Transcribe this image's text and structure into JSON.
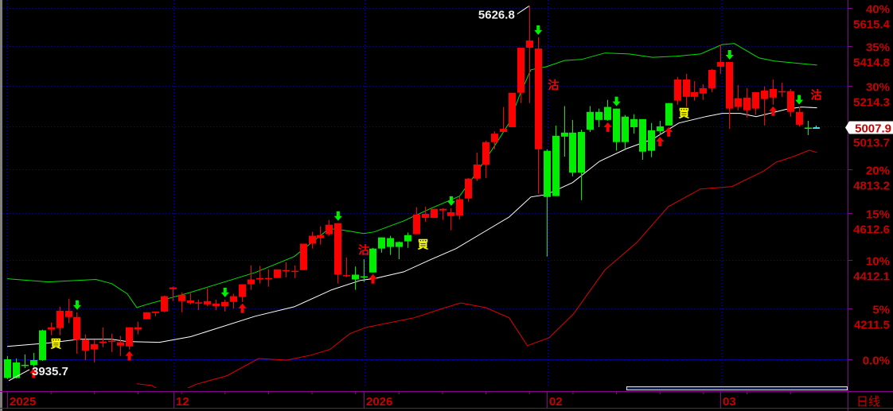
{
  "chart_data": {
    "type": "candlestick",
    "period_label": "日线",
    "y_scale": "log",
    "base_price": 4011,
    "last_price": "5007.9",
    "ylim": [
      3899,
      5657
    ],
    "y_ticks": [
      {
        "pct": "40%",
        "price": "5615.4",
        "ratio": 1.4
      },
      {
        "pct": "35%",
        "price": "5414.8",
        "ratio": 1.35
      },
      {
        "pct": "30%",
        "price": "5214.3",
        "ratio": 1.3
      },
      {
        "pct": "",
        "price": "5013.7",
        "ratio": 1.25
      },
      {
        "pct": "20%",
        "price": "4813.2",
        "ratio": 1.2
      },
      {
        "pct": "15%",
        "price": "4612.6",
        "ratio": 1.15
      },
      {
        "pct": "10%",
        "price": "4412.1",
        "ratio": 1.1
      },
      {
        "pct": "5%",
        "price": "4211.5",
        "ratio": 1.05
      },
      {
        "pct": "0.0%",
        "price": "",
        "ratio": 1.0
      }
    ],
    "x_labels": [
      {
        "label": "2025",
        "index": 0
      },
      {
        "label": "12",
        "index": 19.1
      },
      {
        "label": "2026",
        "index": 41
      },
      {
        "label": "02",
        "index": 62
      },
      {
        "label": "03",
        "index": 82
      }
    ],
    "candles_ohlc": [
      [
        4011,
        4024,
        3936,
        3940
      ],
      [
        3999,
        4014,
        3938,
        3940
      ],
      [
        3990,
        4030,
        3977,
        3989
      ],
      [
        4008,
        4036,
        3983,
        3989
      ],
      [
        4124,
        4127,
        4005,
        4008
      ],
      [
        4127,
        4155,
        4105,
        4136
      ],
      [
        4133,
        4218,
        4105,
        4202
      ],
      [
        4177,
        4251,
        4152,
        4202
      ],
      [
        4086,
        4196,
        4033,
        4177
      ],
      [
        4045,
        4108,
        4008,
        4086
      ],
      [
        4049,
        4086,
        3999,
        4070
      ],
      [
        4074,
        4136,
        4058,
        4080
      ],
      [
        4080,
        4111,
        4039,
        4083
      ],
      [
        4064,
        4102,
        4024,
        4077
      ],
      [
        4061,
        4136,
        4049,
        4136
      ],
      [
        4127,
        4158,
        4108,
        4136
      ],
      [
        4168,
        4196,
        4168,
        4196
      ],
      [
        4193,
        4199,
        4180,
        4199
      ],
      [
        4199,
        4264,
        4196,
        4261
      ],
      [
        4290,
        4300,
        4241,
        4297
      ],
      [
        4241,
        4277,
        4196,
        4267
      ],
      [
        4234,
        4274,
        4228,
        4244
      ],
      [
        4234,
        4247,
        4205,
        4236
      ],
      [
        4228,
        4294,
        4221,
        4241
      ],
      [
        4221,
        4247,
        4205,
        4231
      ],
      [
        4221,
        4247,
        4199,
        4238
      ],
      [
        4238,
        4271,
        4211,
        4261
      ],
      [
        4258,
        4310,
        4238,
        4310
      ],
      [
        4310,
        4389,
        4287,
        4330
      ],
      [
        4330,
        4386,
        4313,
        4336
      ],
      [
        4335,
        4372,
        4300,
        4336
      ],
      [
        4336,
        4372,
        4336,
        4372
      ],
      [
        4368,
        4402,
        4339,
        4369
      ],
      [
        4365,
        4389,
        4336,
        4366
      ],
      [
        4369,
        4481,
        4369,
        4481
      ],
      [
        4481,
        4532,
        4460,
        4515
      ],
      [
        4505,
        4556,
        4477,
        4518
      ],
      [
        4522,
        4584,
        4515,
        4563
      ],
      [
        4350,
        4570,
        4313,
        4570
      ],
      [
        4346,
        4422,
        4339,
        4348
      ],
      [
        4350,
        4384,
        4287,
        4330
      ],
      [
        4343,
        4415,
        4320,
        4342
      ],
      [
        4460,
        4463,
        4359,
        4359
      ],
      [
        4508,
        4508,
        4443,
        4460
      ],
      [
        4505,
        4515,
        4433,
        4467
      ],
      [
        4488,
        4491,
        4415,
        4467
      ],
      [
        4518,
        4529,
        4463,
        4491
      ],
      [
        4522,
        4640,
        4522,
        4608
      ],
      [
        4593,
        4643,
        4576,
        4611
      ],
      [
        4593,
        4633,
        4593,
        4633
      ],
      [
        4626,
        4636,
        4584,
        4633
      ],
      [
        4601,
        4636,
        4539,
        4618
      ],
      [
        4604,
        4690,
        4587,
        4676
      ],
      [
        4679,
        4772,
        4665,
        4769
      ],
      [
        4769,
        4890,
        4758,
        4834
      ],
      [
        4834,
        4946,
        4772,
        4939
      ],
      [
        4939,
        4990,
        4905,
        4979
      ],
      [
        4987,
        5108,
        4987,
        5002
      ],
      [
        5010,
        5178,
        5010,
        5178
      ],
      [
        5178,
        5406,
        5127,
        5406
      ],
      [
        5406,
        5626.8,
        5127,
        5444
      ],
      [
        4905,
        5461,
        4701,
        5402
      ],
      [
        4898,
        4905,
        4426,
        4686
      ],
      [
        4969,
        5018,
        4690,
        4690
      ],
      [
        4984,
        5112,
        4871,
        4965
      ],
      [
        4984,
        5045,
        4780,
        4797
      ],
      [
        4987,
        4998,
        4672,
        4797
      ],
      [
        5084,
        5112,
        4987,
        4998
      ],
      [
        5084,
        5100,
        5010,
        5045
      ],
      [
        5108,
        5143,
        5041,
        5045
      ],
      [
        5100,
        5100,
        4898,
        4939
      ],
      [
        5061,
        5069,
        4905,
        4939
      ],
      [
        5049,
        5073,
        4979,
        5010
      ],
      [
        5049,
        5049,
        4856,
        4894
      ],
      [
        4995,
        5030,
        4868,
        4898
      ],
      [
        5014,
        5041,
        4972,
        4991
      ],
      [
        5127,
        5127,
        5018,
        5018
      ],
      [
        5139,
        5257,
        5119,
        5244
      ],
      [
        5158,
        5273,
        5108,
        5244
      ],
      [
        5158,
        5236,
        5139,
        5181
      ],
      [
        5174,
        5220,
        5143,
        5201
      ],
      [
        5201,
        5297,
        5181,
        5293
      ],
      [
        5309,
        5423,
        5273,
        5333
      ],
      [
        5100,
        5333,
        5002,
        5333
      ],
      [
        5108,
        5216,
        5092,
        5151
      ],
      [
        5092,
        5201,
        5057,
        5154
      ],
      [
        5100,
        5181,
        5069,
        5181
      ],
      [
        5147,
        5209,
        5018,
        5189
      ],
      [
        5154,
        5244,
        5119,
        5197
      ],
      [
        5184,
        5228,
        5158,
        5186
      ],
      [
        5084,
        5197,
        5061,
        5186
      ],
      [
        5022,
        5108,
        5014,
        5084
      ],
      [
        5008,
        5041,
        4972,
        5006
      ],
      [
        5008,
        5018,
        5007.9,
        5007.9
      ]
    ],
    "series": [
      {
        "name": "upper-band",
        "color": "#00e000",
        "points": [
          [
            0,
            4333
          ],
          [
            4.7,
            4320
          ],
          [
            10.2,
            4330
          ],
          [
            12,
            4313
          ],
          [
            13.8,
            4271
          ],
          [
            14.9,
            4215
          ],
          [
            16.1,
            4228
          ],
          [
            21.1,
            4277
          ],
          [
            28.5,
            4359
          ],
          [
            33,
            4426
          ],
          [
            37,
            4546
          ],
          [
            38.2,
            4542
          ],
          [
            41,
            4525
          ],
          [
            42.2,
            4532
          ],
          [
            45.6,
            4580
          ],
          [
            48.6,
            4633
          ],
          [
            52,
            4690
          ],
          [
            53.8,
            4787
          ],
          [
            55.9,
            4913
          ],
          [
            57.7,
            5030
          ],
          [
            58.9,
            5165
          ],
          [
            60.2,
            5293
          ],
          [
            62,
            5309
          ],
          [
            64.1,
            5341
          ],
          [
            66,
            5346
          ],
          [
            68.7,
            5379
          ],
          [
            71.5,
            5374
          ],
          [
            74.2,
            5357
          ],
          [
            76.9,
            5362
          ],
          [
            79.7,
            5374
          ],
          [
            82.2,
            5423
          ],
          [
            83.6,
            5428
          ],
          [
            86.4,
            5354
          ],
          [
            88.2,
            5338
          ],
          [
            93.1,
            5317
          ]
        ]
      },
      {
        "name": "middle-band",
        "color": "#ffffff",
        "points": [
          [
            0,
            4061
          ],
          [
            4.7,
            4074
          ],
          [
            8.3,
            4089
          ],
          [
            12,
            4089
          ],
          [
            13.8,
            4080
          ],
          [
            17.5,
            4077
          ],
          [
            21.1,
            4099
          ],
          [
            28.5,
            4180
          ],
          [
            33,
            4218
          ],
          [
            37.3,
            4287
          ],
          [
            40.6,
            4326
          ],
          [
            42.5,
            4336
          ],
          [
            45.6,
            4362
          ],
          [
            48.6,
            4412
          ],
          [
            51.6,
            4460
          ],
          [
            54.7,
            4529
          ],
          [
            57.7,
            4597
          ],
          [
            60.2,
            4686
          ],
          [
            62,
            4697
          ],
          [
            65,
            4751
          ],
          [
            68.1,
            4849
          ],
          [
            71.2,
            4908
          ],
          [
            74.2,
            4953
          ],
          [
            77.2,
            5030
          ],
          [
            80.3,
            5061
          ],
          [
            82.2,
            5077
          ],
          [
            84.3,
            5077
          ],
          [
            86.1,
            5061
          ],
          [
            89.5,
            5096
          ],
          [
            91.3,
            5108
          ],
          [
            93.1,
            5104
          ]
        ]
      },
      {
        "name": "lower-band",
        "color": "#e00000",
        "points": [
          [
            14.9,
            3918
          ],
          [
            16.6,
            3912
          ],
          [
            18.8,
            3871
          ],
          [
            21.6,
            3915
          ],
          [
            25.3,
            3949
          ],
          [
            28.9,
            4014
          ],
          [
            32.1,
            4008
          ],
          [
            34.9,
            4027
          ],
          [
            37.1,
            4049
          ],
          [
            39.4,
            4111
          ],
          [
            41.3,
            4136
          ],
          [
            46.8,
            4174
          ],
          [
            49.5,
            4205
          ],
          [
            52.1,
            4234
          ],
          [
            55,
            4215
          ],
          [
            57.7,
            4174
          ],
          [
            59.8,
            4064
          ],
          [
            62.3,
            4095
          ],
          [
            65.1,
            4189
          ],
          [
            68.7,
            4369
          ],
          [
            72.4,
            4487
          ],
          [
            76,
            4643
          ],
          [
            79.7,
            4722
          ],
          [
            83.3,
            4733
          ],
          [
            87,
            4805
          ],
          [
            88.4,
            4845
          ],
          [
            90.4,
            4871
          ],
          [
            92.2,
            4901
          ],
          [
            93.1,
            4890
          ]
        ]
      }
    ],
    "signals": [
      {
        "type": "buy",
        "label": "買",
        "index": 5.6,
        "price": 4074
      },
      {
        "type": "buy",
        "label": "買",
        "index": 47.8,
        "price": 4481
      },
      {
        "type": "buy",
        "label": "買",
        "index": 77.8,
        "price": 5081
      },
      {
        "type": "sell",
        "label": "沽",
        "index": 41,
        "price": 4458
      },
      {
        "type": "sell",
        "label": "沽",
        "index": 62.8,
        "price": 5220
      },
      {
        "type": "sell",
        "label": "沽",
        "index": 93,
        "price": 5171
      }
    ],
    "down_arrows": [
      8,
      25,
      38,
      51,
      61,
      70,
      83,
      91
    ],
    "up_arrows": [
      3,
      14,
      27,
      42,
      69,
      75,
      76,
      88
    ],
    "annotations": [
      {
        "label": "5626.8",
        "index": 60,
        "price": 5626.8,
        "kind": "high"
      },
      {
        "label": "3935.7",
        "index": 0,
        "price": 3935.7,
        "kind": "low"
      }
    ]
  }
}
